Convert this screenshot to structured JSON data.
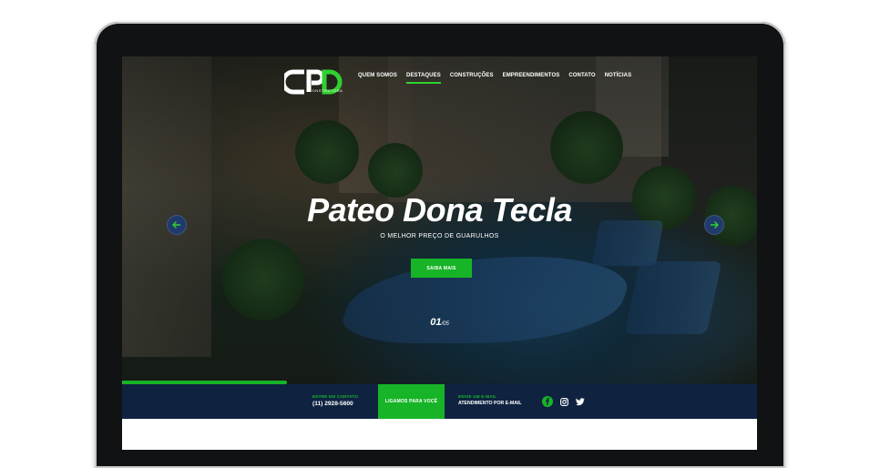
{
  "nav": {
    "logo_sub": "CONSTRUTORA",
    "items": [
      {
        "label": "QUEM SOMOS"
      },
      {
        "label": "DESTAQUES"
      },
      {
        "label": "CONSTRUÇÕES"
      },
      {
        "label": "EMPREENDIMENTOS"
      },
      {
        "label": "CONTATO"
      },
      {
        "label": "NOTÍCIAS"
      }
    ],
    "active": "DESTAQUES"
  },
  "hero": {
    "title": "Pateo Dona Tecla",
    "subtitle": "O MELHOR PREÇO DE GUARULHOS",
    "cta": "SAIBA MAIS",
    "slide_current": "01",
    "slide_total": "/05",
    "progress": 0.26
  },
  "contact_bar": {
    "phone_label": "ENTRE EM CONTATO",
    "phone": "(11) 2928-5600",
    "callback": "LIGAMOS PARA VOCÊ",
    "email_label": "ENVIE UM E-MAIL",
    "email_text": "ATENDIMENTO POR E-MAIL"
  },
  "colors": {
    "accent": "#17b427",
    "bar": "#0f2341",
    "arrow": "#1f3a6b"
  },
  "icons": [
    "arrow-left-icon",
    "arrow-right-icon",
    "facebook-icon",
    "instagram-icon",
    "twitter-icon"
  ]
}
